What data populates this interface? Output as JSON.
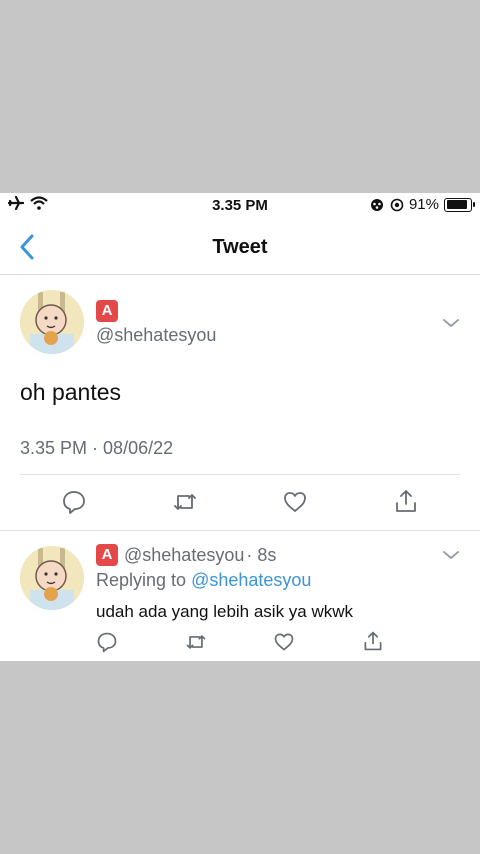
{
  "status_bar": {
    "time": "3.35 PM",
    "battery": "91%",
    "icons": [
      "airplane-icon",
      "wifi-icon",
      "vpn-icon",
      "location-icon",
      "battery-icon"
    ]
  },
  "nav": {
    "title": "Tweet"
  },
  "tweet": {
    "badge": "A",
    "handle": "@shehatesyou",
    "text": "oh pantes",
    "time": "3.35 PM",
    "separator": " · ",
    "date": "08/06/22",
    "actions": [
      "reply-icon",
      "retweet-icon",
      "like-icon",
      "share-icon"
    ]
  },
  "reply": {
    "badge": "A",
    "handle": "@shehatesyou",
    "age": "· 8s",
    "replying_label": "Replying to",
    "replying_to": "@shehatesyou",
    "text": "udah ada yang lebih asik ya wkwk"
  },
  "colors": {
    "link": "#3b94d9",
    "badge": "#e54848",
    "muted": "#666c72"
  }
}
